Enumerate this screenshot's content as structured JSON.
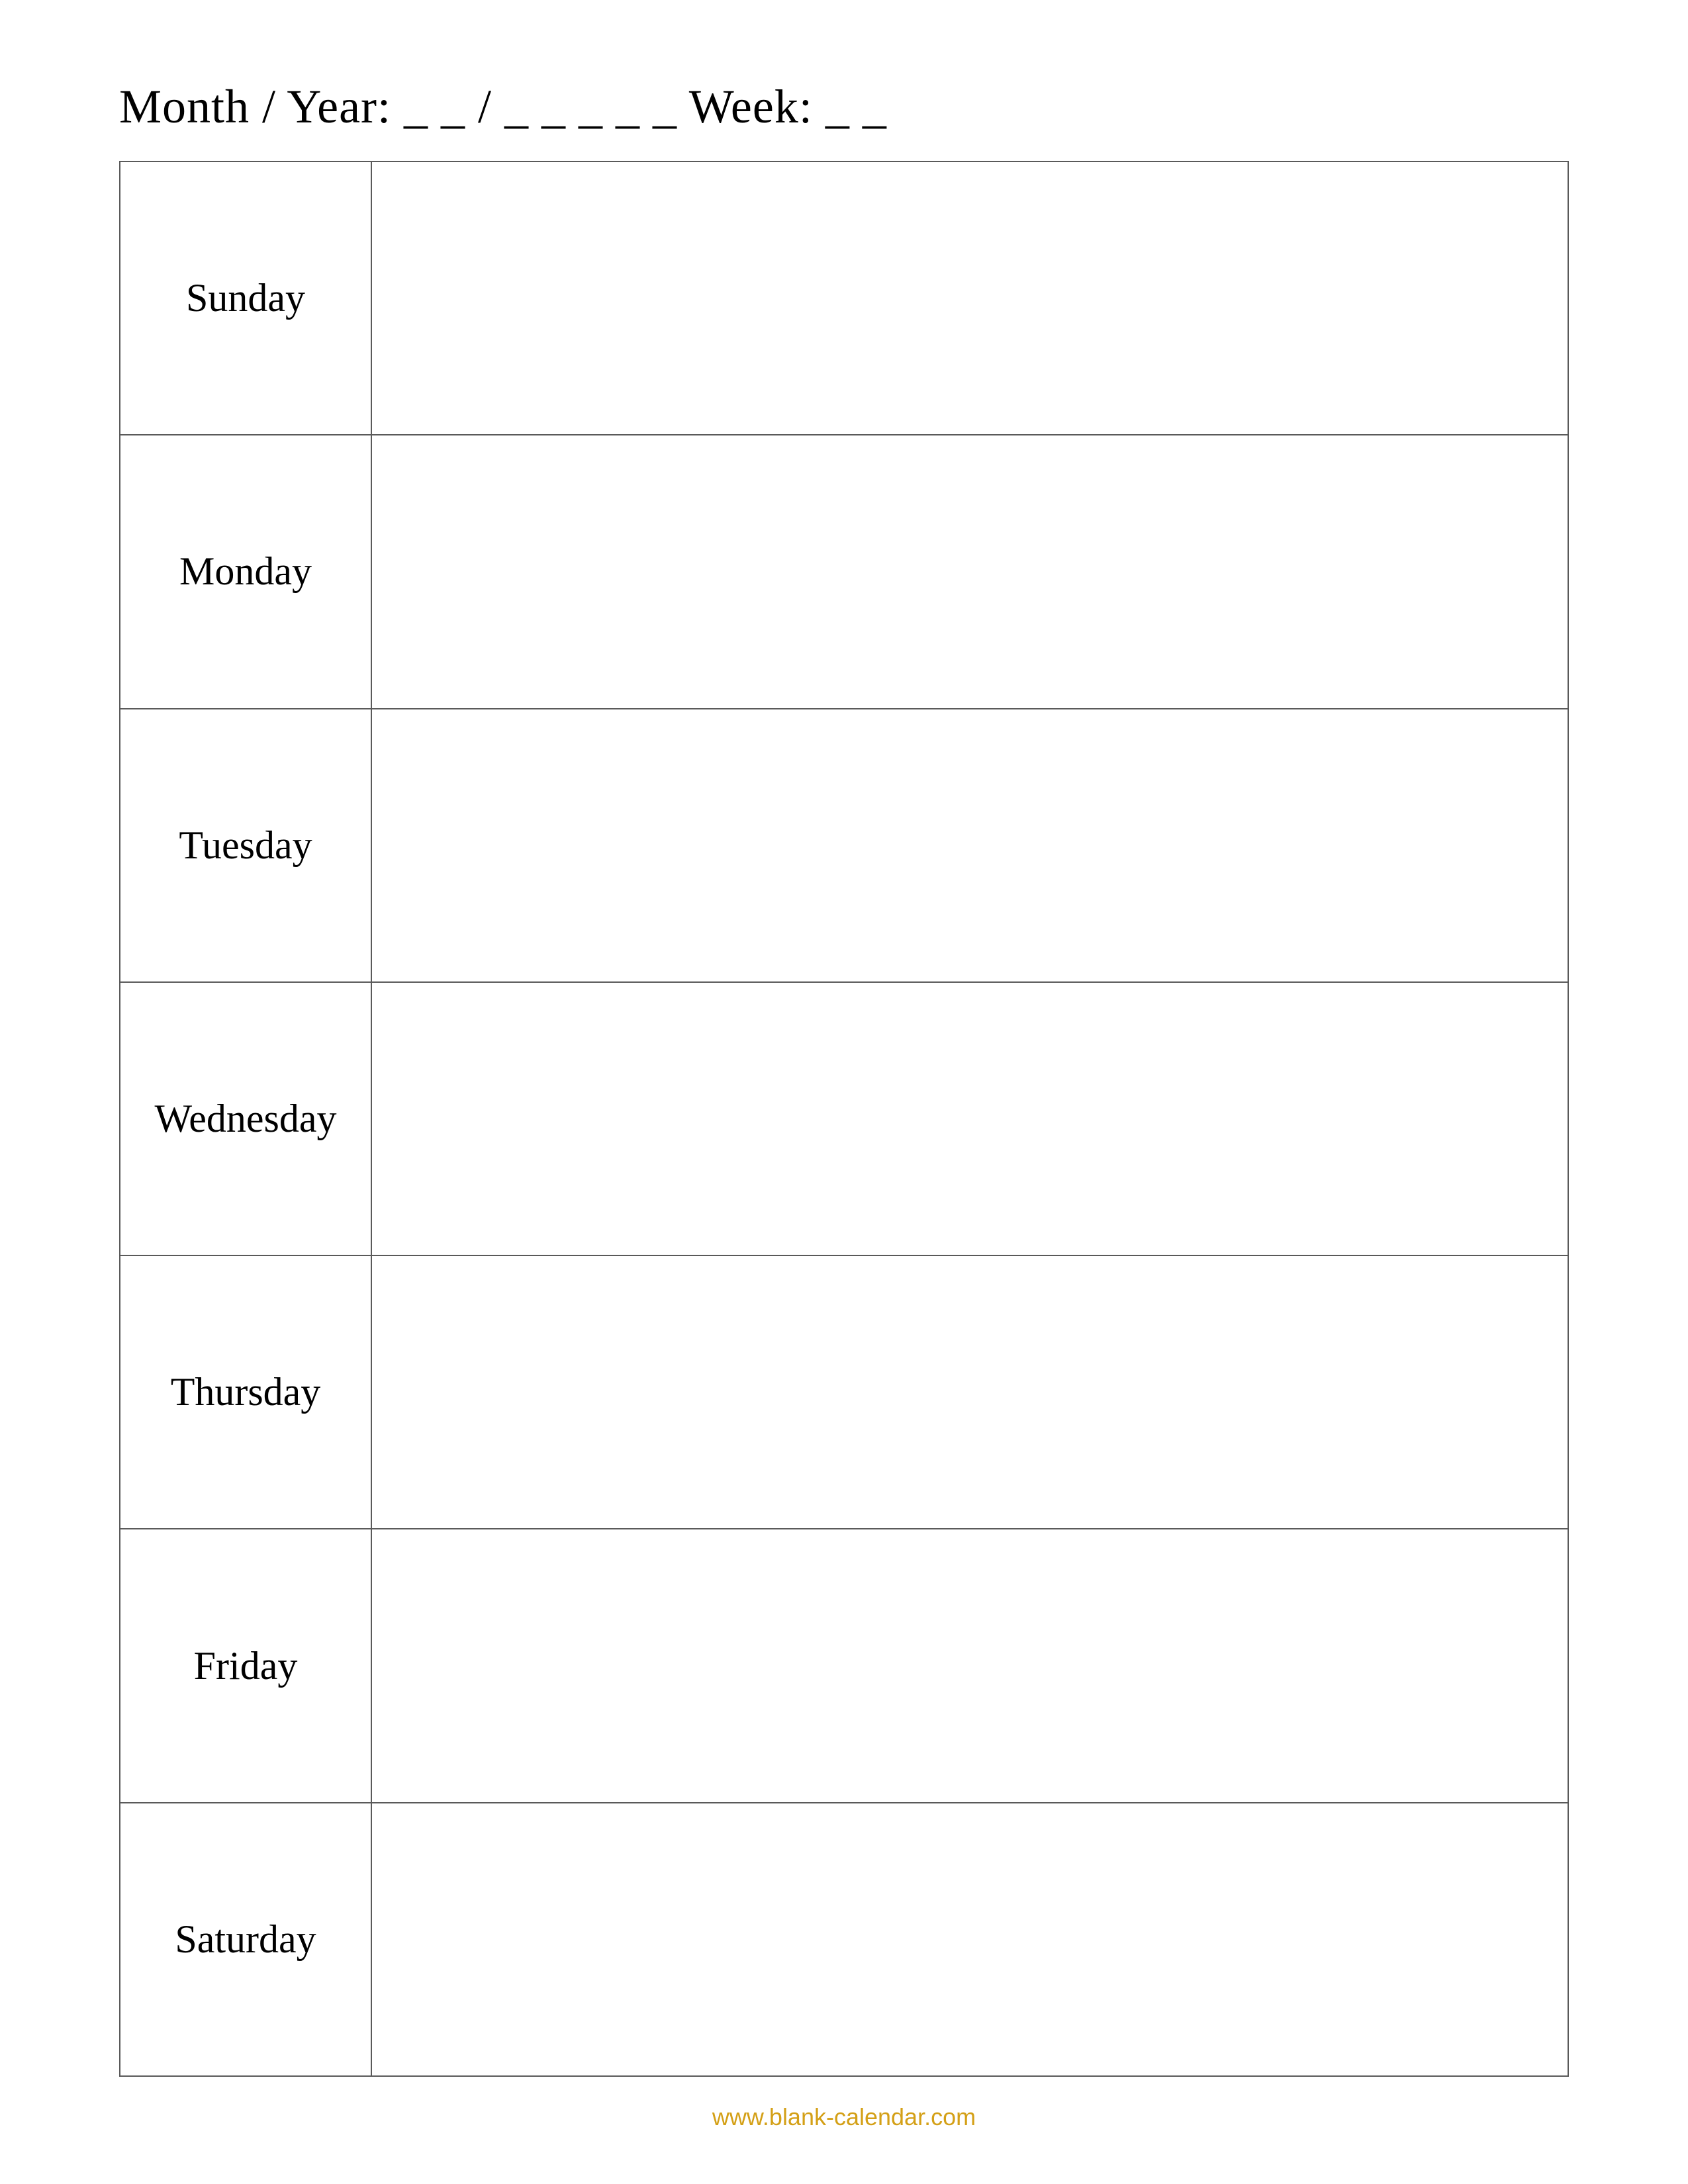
{
  "header": {
    "label": "Month / Year: _ _ / _ _ _ _ _   Week: _ _"
  },
  "days": [
    {
      "name": "Sunday"
    },
    {
      "name": "Monday"
    },
    {
      "name": "Tuesday"
    },
    {
      "name": "Wednesday"
    },
    {
      "name": "Thursday"
    },
    {
      "name": "Friday"
    },
    {
      "name": "Saturday"
    }
  ],
  "footer": {
    "url": "www.blank-calendar.com"
  }
}
